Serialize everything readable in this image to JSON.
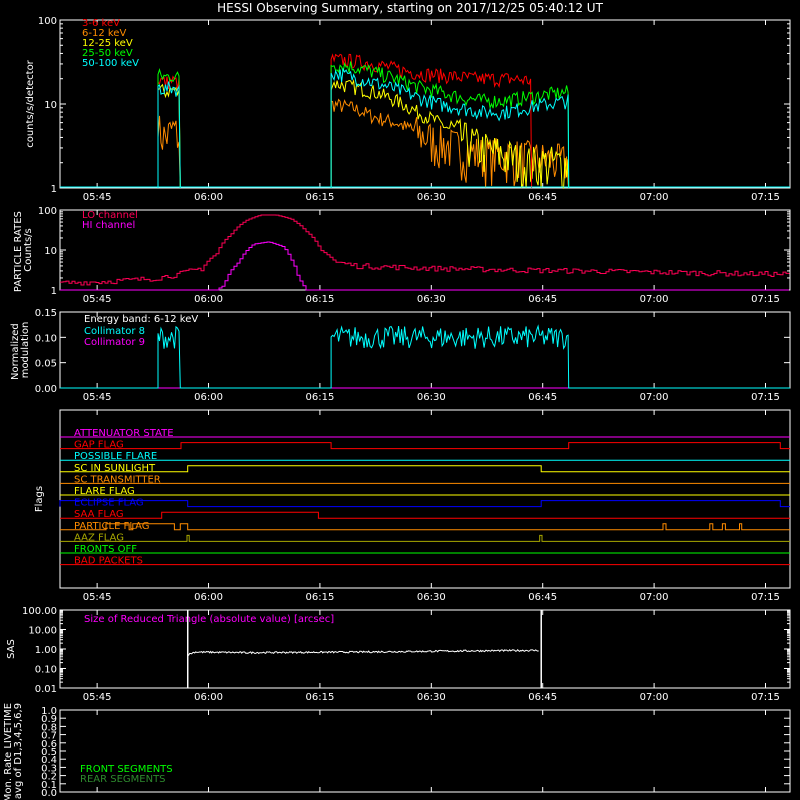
{
  "title": "HESSI Observing Summary, starting on 2017/12/25 05:40:12 UT",
  "time_axis": {
    "range_min": [
      340,
      800
    ],
    "ticks": [
      {
        "label": "05:45",
        "min": 345
      },
      {
        "label": "06:00",
        "min": 360
      },
      {
        "label": "06:15",
        "min": 375
      },
      {
        "label": "06:30",
        "min": 390
      },
      {
        "label": "06:45",
        "min": 405
      },
      {
        "label": "07:00",
        "min": 420
      },
      {
        "label": "07:15",
        "min": 435
      }
    ]
  },
  "colors": {
    "red": "#ff0000",
    "orange": "#ff8c00",
    "yellow": "#ffff00",
    "green": "#00ff00",
    "cyan": "#00ffff",
    "magenta": "#ff00ff",
    "crimson": "#ff0055",
    "blue": "#0000ff",
    "olive": "#a8a800",
    "white": "#ffffff"
  },
  "chart_data": [
    {
      "type": "line",
      "id": "counts",
      "ylabel": "counts/s/detector",
      "yscale": "log",
      "ylim": [
        1,
        100
      ],
      "yticks": [
        "1",
        "10",
        "100"
      ],
      "series": [
        {
          "name": "3-6 keV",
          "color": "red",
          "segments": [
            {
              "t": [
                353.2,
                356.2
              ],
              "level": [
                20,
                18,
                19,
                17
              ]
            },
            {
              "t": [
                376.5,
                403.5
              ],
              "level": [
                34,
                33,
                31,
                28,
                25,
                23,
                22,
                21,
                20,
                20,
                20,
                19
              ]
            }
          ]
        },
        {
          "name": "6-12 keV",
          "color": "orange",
          "segments": [
            {
              "t": [
                353.2,
                356.2
              ],
              "level": [
                5,
                4,
                5,
                4
              ]
            },
            {
              "t": [
                376.5,
                408.5
              ],
              "level": [
                10,
                9,
                7,
                6,
                4.5,
                3.5,
                3,
                2.5,
                2.5,
                2.3,
                2.2,
                2
              ]
            }
          ]
        },
        {
          "name": "12-25 keV",
          "color": "yellow",
          "segments": [
            {
              "t": [
                353.2,
                356.2
              ],
              "level": [
                15,
                14,
                15,
                13
              ]
            },
            {
              "t": [
                376.5,
                408.5
              ],
              "level": [
                18,
                16,
                14,
                11,
                8,
                6,
                4,
                3,
                2.5,
                2,
                2,
                2
              ]
            }
          ]
        },
        {
          "name": "25-50 keV",
          "color": "green",
          "segments": [
            {
              "t": [
                353.2,
                356.2
              ],
              "level": [
                22,
                21,
                22,
                20
              ]
            },
            {
              "t": [
                376.5,
                408.5
              ],
              "level": [
                30,
                28,
                24,
                20,
                16,
                14,
                12,
                11,
                11,
                12,
                13,
                14
              ]
            }
          ]
        },
        {
          "name": "50-100 keV",
          "color": "cyan",
          "segments": [
            {
              "t": [
                353.2,
                356.2
              ],
              "level": [
                16,
                15,
                16,
                14
              ]
            },
            {
              "t": [
                376.5,
                408.5
              ],
              "level": [
                24,
                21,
                18,
                15,
                12,
                10,
                9,
                8,
                8,
                9,
                10,
                11
              ]
            }
          ]
        }
      ]
    },
    {
      "type": "line",
      "id": "particle",
      "ylabel": "PARTICLE RATES Counts/s",
      "yscale": "log",
      "ylim": [
        1,
        100
      ],
      "yticks": [
        "1",
        "10",
        "100"
      ],
      "series": [
        {
          "name": "LO channel",
          "color": "crimson",
          "t": [
            340,
            345,
            350,
            353,
            356,
            359,
            361,
            363,
            365,
            367,
            369,
            371,
            373,
            375,
            377,
            380,
            390,
            400,
            410,
            420,
            430,
            437
          ],
          "y": [
            1.5,
            1.6,
            1.8,
            2.0,
            2.5,
            3.5,
            8,
            25,
            55,
            75,
            75,
            60,
            30,
            10,
            5,
            4,
            3.5,
            3.2,
            3.0,
            2.8,
            2.6,
            2.5
          ]
        },
        {
          "name": "HI channel",
          "color": "magenta",
          "t": [
            340,
            361,
            362,
            364,
            366,
            368,
            370,
            371,
            372,
            373,
            437
          ],
          "y": [
            1,
            1,
            1.3,
            5,
            14,
            16,
            12,
            6,
            2,
            1,
            1
          ]
        }
      ]
    },
    {
      "type": "line",
      "id": "modulation",
      "ylabel": "Normalized modulation",
      "ylim": [
        0,
        0.15
      ],
      "yticks": [
        "0.00",
        "0.05",
        "0.10",
        "0.15"
      ],
      "annotation": "Energy band: 6-12 keV",
      "series": [
        {
          "name": "Collimator 8",
          "color": "cyan",
          "segments": [
            [
              353.2,
              356.2
            ],
            [
              376.5,
              408.5
            ]
          ],
          "level": 0.1
        },
        {
          "name": "Collimator 9",
          "color": "magenta",
          "level": 0
        }
      ]
    },
    {
      "type": "line",
      "id": "flags",
      "ylabel": "Flags",
      "flags": [
        {
          "name": "ATTENUATOR STATE",
          "color": "magenta",
          "low": [
            [
              340,
              437
            ]
          ]
        },
        {
          "name": "GAP FLAG",
          "color": "red",
          "high": [
            [
              356.3,
              376.5
            ],
            [
              408.5,
              437
            ]
          ]
        },
        {
          "name": "POSSIBLE FLARE",
          "color": "cyan",
          "high": []
        },
        {
          "name": "SC IN SUNLIGHT",
          "color": "yellow",
          "high": [
            [
              357.2,
              404.8
            ]
          ]
        },
        {
          "name": "SC TRANSMITTER",
          "color": "orange",
          "high": []
        },
        {
          "name": "FLARE FLAG",
          "color": "yellow",
          "high": []
        },
        {
          "name": "ECLIPSE FLAG",
          "color": "blue",
          "high": [
            [
              340,
              357.2
            ],
            [
              404.8,
              437
            ]
          ]
        },
        {
          "name": "SAA FLAG",
          "color": "red",
          "high": [
            [
              353.7,
              374.8
            ]
          ]
        },
        {
          "name": "PARTICLE FLAG",
          "color": "orange",
          "high": [
            [
              346.2,
              349.3
            ],
            [
              349.8,
              355.4
            ],
            [
              356.2,
              357.2
            ],
            [
              421.2,
              421.6
            ],
            [
              427.5,
              427.9
            ],
            [
              429.2,
              429.6
            ],
            [
              431.5,
              431.8
            ]
          ]
        },
        {
          "name": "AAZ FLAG",
          "color": "olive",
          "high": [
            [
              357.1,
              357.4
            ],
            [
              404.6,
              404.9
            ]
          ]
        },
        {
          "name": "FRONTS OFF",
          "color": "green",
          "high": []
        },
        {
          "name": "BAD PACKETS",
          "color": "red",
          "high": []
        }
      ]
    },
    {
      "type": "line",
      "id": "sas",
      "ylabel": "SAS",
      "yscale": "log",
      "ylim": [
        0.01,
        100
      ],
      "yticks": [
        "0.01",
        "0.10",
        "1.00",
        "10.00",
        "100.00"
      ],
      "annotation": "Size of Reduced Triangle (absolute value) [arcsec]",
      "series": [
        {
          "name": "Size of Reduced Triangle",
          "color": "white",
          "t": [
            357.2,
            358.2,
            365,
            380,
            395,
            404.5
          ],
          "y": [
            0.5,
            0.7,
            0.65,
            0.7,
            0.8,
            0.85
          ],
          "spikes": [
            357.2,
            404.8
          ]
        }
      ]
    },
    {
      "type": "line",
      "id": "livetime",
      "ylabel": "Mon. Rate LIVETIME avg of D1,3,4,5,6,9",
      "ylim": [
        0,
        1
      ],
      "yticks": [
        "0.0",
        "0.1",
        "0.2",
        "0.3",
        "0.4",
        "0.5",
        "0.6",
        "0.7",
        "0.8",
        "0.9",
        "1.0"
      ],
      "series": [
        {
          "name": "FRONT SEGMENTS",
          "color": "green"
        },
        {
          "name": "REAR SEGMENTS",
          "color": "green"
        }
      ]
    }
  ]
}
